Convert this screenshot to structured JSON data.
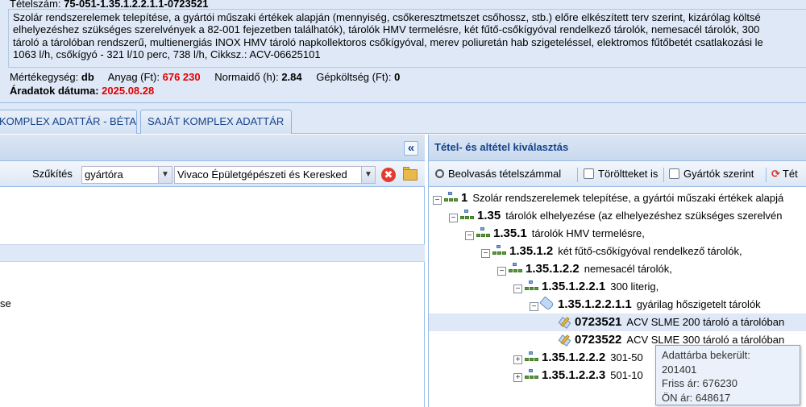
{
  "info": {
    "item_id_label": "Tételszám:",
    "item_id_value": "75-051-1.35.1.2.2.1.1-0723521",
    "description_lines": [
      "Szolár rendszerelemek telepítése, a gyártói műszaki értékek alapján (mennyiség, csőkeresztmetszet csőhossz, stb.) előre elkészített terv szerint,  kizárólag költsé",
      "elhelyezéshez szükséges szerelvények a 82-001 fejezetben találhatók), tárolók HMV termelésre, két fűtő-csőkígyóval rendelkező tárolók, nemesacél tárolók, 300",
      "tároló a tárolóban rendszerű, multienergiás INOX HMV tároló napkollektoros csőkígyóval, merev poliuretán hab szigeteléssel, elektromos fűtőbetét csatlakozási le",
      "1063 l/h, csőkígyó - 321 l/10 perc, 738 l/h, Cikksz.: ACV-06625101"
    ],
    "unit_label": "Mértékegység:",
    "unit_value": "db",
    "material_label": "Anyag (Ft):",
    "material_value": "676 230",
    "normtime_label": "Normaidő (h):",
    "normtime_value": "2.84",
    "machine_label": "Gépköltség (Ft):",
    "machine_value": "0",
    "price_date_label": "Áradatok dátuma:",
    "price_date_value": "2025.08.28"
  },
  "tabs": {
    "tab1_label": "KOMPLEX ADATTÁR - BÉTA",
    "tab2_label": "SAJÁT KOMPLEX ADATTÁR"
  },
  "left_panel": {
    "collapse_glyph": "«",
    "filter_label": "Szűkítés",
    "filter_type_value": "gyártóra",
    "filter_value": "Vivaco Épületgépészeti és Keresked",
    "row_fragment": "se",
    "clear_glyph": "✖"
  },
  "right_panel": {
    "title": "Tétel- és altétel kiválasztás",
    "toolbar": {
      "scan_label": "Beolvasás tételszámmal",
      "deleted_label": "Töröltteket is",
      "manufacturer_label": "Gyártók szerint",
      "refresh_label": "Tét"
    },
    "tree": [
      {
        "code": "1",
        "label": "Szolár rendszerelemek telepítése, a gyártói műszaki értékek alapjá"
      },
      {
        "code": "1.35",
        "label": "tárolók elhelyezése (az elhelyezéshez szükséges szerelvén"
      },
      {
        "code": "1.35.1",
        "label": "tárolók HMV termelésre,"
      },
      {
        "code": "1.35.1.2",
        "label": "két fűtő-csőkígyóval rendelkező tárolók,"
      },
      {
        "code": "1.35.1.2.2",
        "label": "nemesacél tárolók,"
      },
      {
        "code": "1.35.1.2.2.1",
        "label": "300 literig,"
      },
      {
        "code": "1.35.1.2.2.1.1",
        "label": "gyárilag hőszigetelt tárolók"
      },
      {
        "code": "0723521",
        "label": "ACV SLME 200 tároló a tárolóban"
      },
      {
        "code": "0723522",
        "label": "ACV SLME 300 tároló a tárolóban"
      },
      {
        "code": "1.35.1.2.2.2",
        "label": "301-50"
      },
      {
        "code": "1.35.1.2.2.3",
        "label": "501-10"
      }
    ]
  },
  "tooltip": {
    "line1": "Adattárba bekerült:",
    "line2": "201401",
    "line3": "Friss ár: 676230",
    "line4": "ÖN ár: 648617"
  }
}
